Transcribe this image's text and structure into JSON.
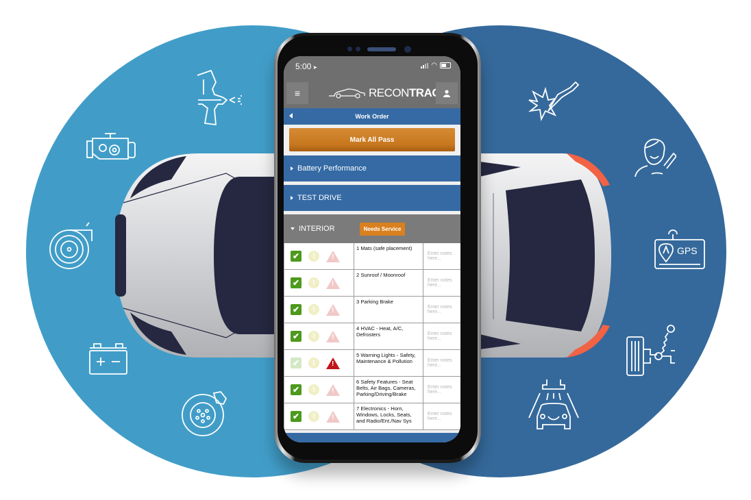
{
  "colors": {
    "left_circle": "#419dc8",
    "right_circle": "#35699b",
    "app_gray": "#6f6f6f",
    "app_blue": "#356aa4",
    "accent_orange": "#d9801f",
    "pass_green": "#4d9a1c",
    "fail_red": "#c0141b",
    "car_dark": "#252840",
    "car_accent": "#f26244"
  },
  "decor_icons_left": [
    "spray-gun-icon",
    "engine-icon",
    "turbo-icon",
    "battery-icon",
    "brake-disc-icon"
  ],
  "decor_icons_right": [
    "spark-plug-icon",
    "driver-seatbelt-icon",
    "gps-icon",
    "suspension-icon",
    "car-wash-icon"
  ],
  "gps_label": "GPS",
  "status_bar": {
    "time": "5:00",
    "location_icon": "location-arrow-icon"
  },
  "app_bar": {
    "menu_icon": "≡",
    "logo_light": "RECON",
    "logo_bold": "TRAC",
    "user_icon": "user-icon"
  },
  "nav": {
    "title": "Work Order"
  },
  "actions": {
    "mark_all_pass": "Mark All Pass"
  },
  "sections": [
    {
      "label": "Battery Performance",
      "expanded": false
    },
    {
      "label": "TEST DRIVE",
      "expanded": false
    },
    {
      "label": "INTERIOR",
      "expanded": true,
      "badge": "Needs Service"
    }
  ],
  "items": [
    {
      "name": "1 Mats (safe placement)",
      "pass": true,
      "warn": false,
      "fail": false,
      "notes_placeholder": "Enter notes here..."
    },
    {
      "name": "2 Sunroof / Moonroof",
      "pass": true,
      "warn": false,
      "fail": false,
      "notes_placeholder": "Enter notes here..."
    },
    {
      "name": "3 Parking Brake",
      "pass": true,
      "warn": false,
      "fail": false,
      "notes_placeholder": "Enter notes here..."
    },
    {
      "name": "4 HVAC - Heat, A/C, Defrosters",
      "pass": true,
      "warn": false,
      "fail": false,
      "notes_placeholder": "Enter notes here..."
    },
    {
      "name": "5 Warning Lights - Safety, Maintenance & Pollution",
      "pass": false,
      "warn": false,
      "fail": true,
      "notes_placeholder": "Enter notes here..."
    },
    {
      "name": "6 Safety Features - Seat Belts, Air Bags, Cameras, Parking/Driving/Brake",
      "pass": true,
      "warn": false,
      "fail": false,
      "notes_placeholder": "Enter notes here..."
    },
    {
      "name": "7 Electronics - Horn, Windows, Locks, Seats, and Radio/Ent./Nav Sys",
      "pass": true,
      "warn": false,
      "fail": false,
      "notes_placeholder": "Enter notes here..."
    }
  ]
}
